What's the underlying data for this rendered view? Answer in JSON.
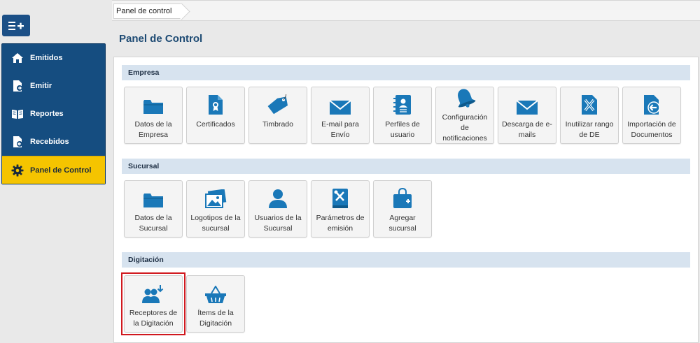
{
  "breadcrumb": "Panel de control",
  "page_title": "Panel de Control",
  "sidebar": {
    "menu_icon": "menu-add-icon",
    "items": [
      {
        "label": "Emitidos",
        "icon": "home-icon"
      },
      {
        "label": "Emitir",
        "icon": "document-arrow-icon"
      },
      {
        "label": "Reportes",
        "icon": "book-icon"
      },
      {
        "label": "Recebidos",
        "icon": "document-in-icon"
      },
      {
        "label": "Panel de Control",
        "icon": "gear-icon"
      }
    ]
  },
  "sections": {
    "empresa": {
      "title": "Empresa",
      "tiles": [
        {
          "label": "Datos de la Empresa",
          "icon": "folder-icon"
        },
        {
          "label": "Certificados",
          "icon": "certificate-icon"
        },
        {
          "label": "Timbrado",
          "icon": "tag-icon"
        },
        {
          "label": "E-mail para Envío",
          "icon": "envelope-icon"
        },
        {
          "label": "Perfiles de usuario",
          "icon": "contact-book-icon"
        },
        {
          "label": "Configuración de notificaciones",
          "icon": "bell-icon"
        },
        {
          "label": "Descarga de e-mails",
          "icon": "envelope-icon"
        },
        {
          "label": "Inutilizar rango de DE",
          "icon": "document-x-icon"
        },
        {
          "label": "Importación de Documentos",
          "icon": "document-import-icon"
        }
      ]
    },
    "sucursal": {
      "title": "Sucursal",
      "tiles": [
        {
          "label": "Datos de la Sucursal",
          "icon": "folder-icon"
        },
        {
          "label": "Logotipos de la sucursal",
          "icon": "image-icon"
        },
        {
          "label": "Usuarios de la Sucursal",
          "icon": "user-icon"
        },
        {
          "label": "Parámetros de emisión",
          "icon": "tools-book-icon"
        },
        {
          "label": "Agregar sucursal",
          "icon": "bag-plus-icon"
        }
      ]
    },
    "digitacion": {
      "title": "Digitación",
      "tiles": [
        {
          "label": "Receptores de la Digitación",
          "icon": "users-download-icon"
        },
        {
          "label": "Ítems de la Digitación",
          "icon": "basket-icon"
        }
      ]
    }
  },
  "colors": {
    "sidebar_bg": "#154d80",
    "active_bg": "#f5c400",
    "icon_blue": "#1a78b8",
    "section_bar": "#d7e3ef",
    "highlight": "#d0181e"
  }
}
